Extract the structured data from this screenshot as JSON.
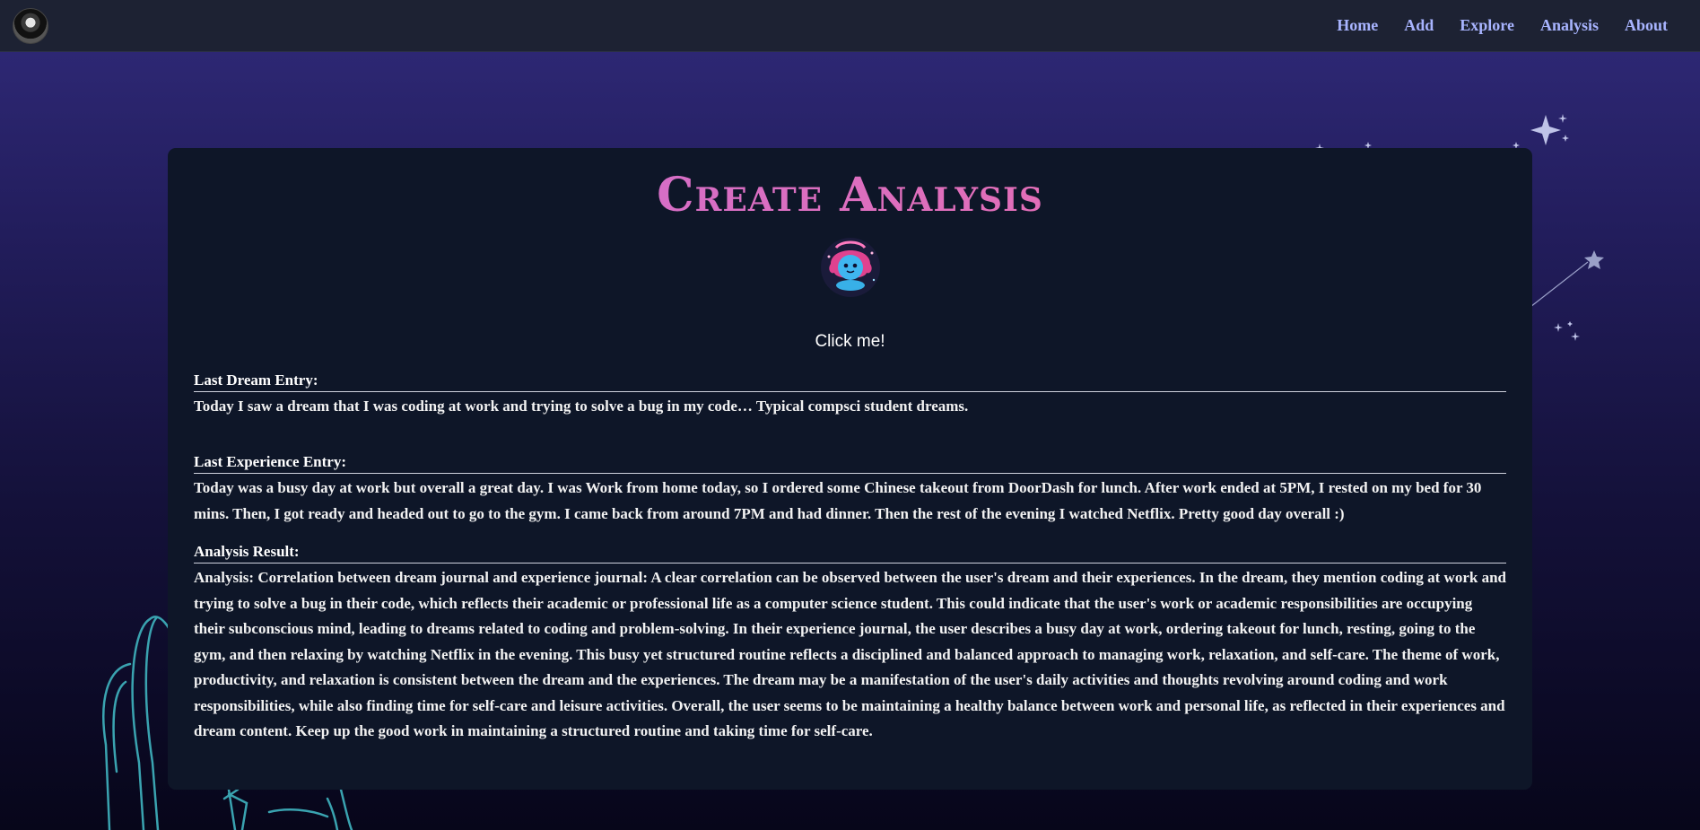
{
  "nav": {
    "links": [
      "Home",
      "Add",
      "Explore",
      "Analysis",
      "About"
    ]
  },
  "main": {
    "title": "Create Analysis",
    "button_label": "Click me!",
    "dream": {
      "label": "Last Dream Entry:",
      "text": "Today I saw a dream that I was coding at work and trying to solve a bug in my code… Typical compsci student dreams."
    },
    "experience": {
      "label": "Last Experience Entry:",
      "text": "Today was a busy day at work but overall a great day. I was Work from home today, so I ordered some Chinese takeout from DoorDash for lunch. After work ended at 5PM, I rested on my bed for 30 mins. Then, I got ready and headed out to go to the gym. I came back from around 7PM and had dinner. Then the rest of the evening I watched Netflix. Pretty good day overall :)"
    },
    "analysis": {
      "label": "Analysis Result:",
      "text": "Analysis: Correlation between dream journal and experience journal: A clear correlation can be observed between the user's dream and their experiences. In the dream, they mention coding at work and trying to solve a bug in their code, which reflects their academic or professional life as a computer science student. This could indicate that the user's work or academic responsibilities are occupying their subconscious mind, leading to dreams related to coding and problem-solving. In their experience journal, the user describes a busy day at work, ordering takeout for lunch, resting, going to the gym, and then relaxing by watching Netflix in the evening. This busy yet structured routine reflects a disciplined and balanced approach to managing work, relaxation, and self-care. The theme of work, productivity, and relaxation is consistent between the dream and the experiences. The dream may be a manifestation of the user's daily activities and thoughts revolving around coding and work responsibilities, while also finding time for self-care and leisure activities. Overall, the user seems to be maintaining a healthy balance between work and personal life, as reflected in their experiences and dream content. Keep up the good work in maintaining a structured routine and taking time for self-care."
    }
  },
  "colors": {
    "nav_bg": "#1d2233",
    "nav_link": "#a8b4ff",
    "card_bg": "#0e1628",
    "title_gradient_start": "#c86fd6",
    "title_gradient_end": "#f06da8",
    "chair_outline": "#3aa3b0"
  },
  "icons": [
    "avatar",
    "mascot-icon",
    "sparkle-star-icon",
    "shooting-star-icon",
    "chair-illustration"
  ]
}
